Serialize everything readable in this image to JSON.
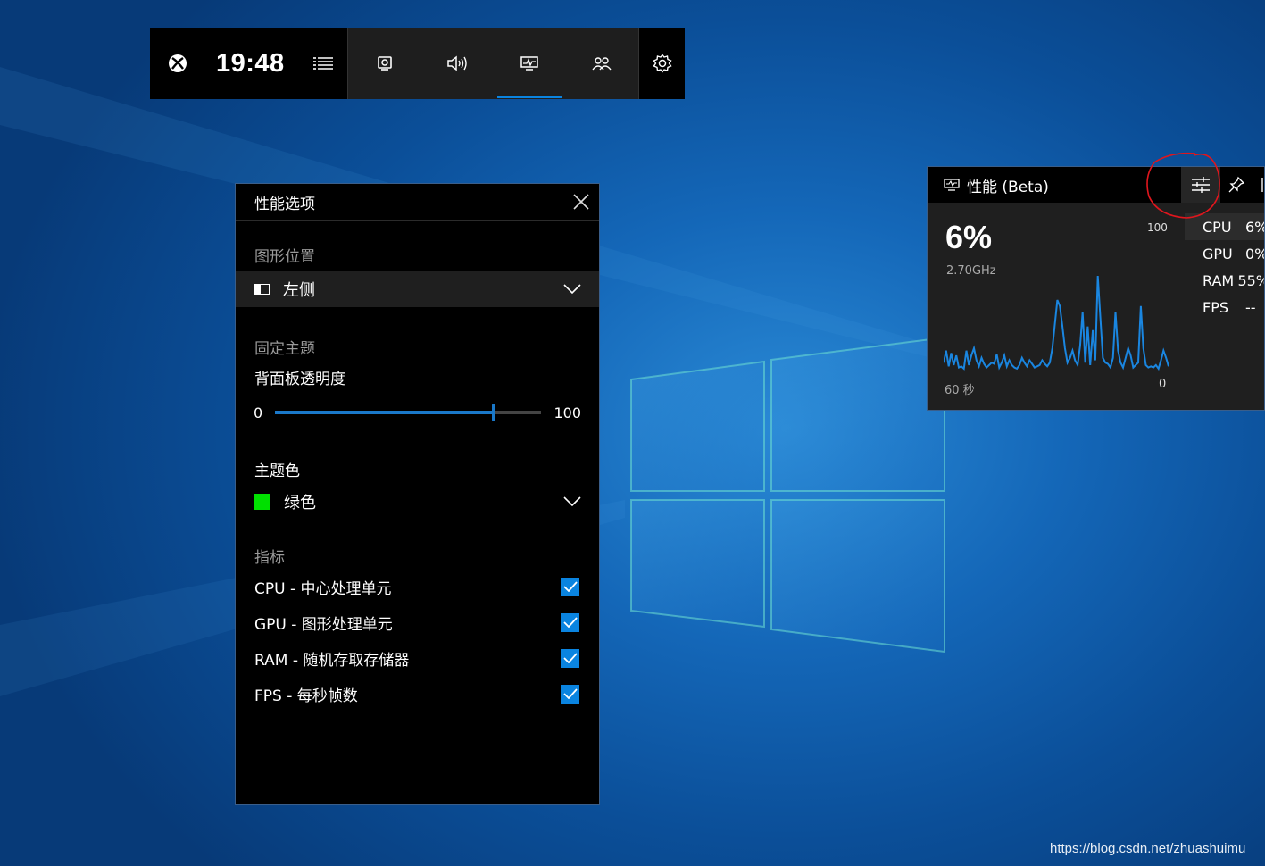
{
  "gamebar": {
    "time": "19:48",
    "icons": [
      "xbox-icon",
      "widget-menu-icon",
      "capture-icon",
      "audio-icon",
      "performance-icon",
      "social-icon",
      "settings-gear-icon"
    ],
    "active_tab": "performance"
  },
  "options_panel": {
    "title": "性能选项",
    "position_label": "图形位置",
    "position_value": "左侧",
    "pin_theme_label": "固定主题",
    "opacity_label": "背面板透明度",
    "opacity_min": "0",
    "opacity_max": "100",
    "opacity_value": 82,
    "theme_color_label": "主题色",
    "theme_color_value": "绿色",
    "theme_color_hex": "#00e000",
    "metrics_label": "指标",
    "metrics": [
      {
        "label": "CPU - 中心处理单元",
        "checked": true
      },
      {
        "label": "GPU - 图形处理单元",
        "checked": true
      },
      {
        "label": "RAM - 随机存取存储器",
        "checked": true
      },
      {
        "label": "FPS - 每秒帧数",
        "checked": true
      }
    ]
  },
  "perf_widget": {
    "title": "性能 (Beta)",
    "big_value": "6%",
    "frequency": "2.70GHz",
    "y_max": "100",
    "y_min": "0",
    "time_span": "60 秒",
    "cpu_history": [
      8,
      18,
      5,
      16,
      6,
      14,
      4,
      5,
      3,
      18,
      6,
      14,
      20,
      10,
      5,
      12,
      7,
      4,
      6,
      8,
      7,
      15,
      4,
      8,
      14,
      5,
      10,
      6,
      4,
      3,
      6,
      12,
      8,
      5,
      10,
      7,
      4,
      5,
      6,
      10,
      7,
      5,
      8,
      20,
      40,
      60,
      55,
      38,
      20,
      8,
      12,
      18,
      10,
      6,
      22,
      50,
      8,
      38,
      6,
      35,
      10,
      80,
      45,
      12,
      8,
      7,
      4,
      12,
      50,
      18,
      8,
      4,
      12,
      20,
      14,
      4,
      6,
      8,
      55,
      20,
      6,
      4,
      5,
      4,
      6,
      3,
      10,
      18,
      12,
      5
    ],
    "sidebar": [
      {
        "name": "CPU",
        "value": "6%",
        "selected": true
      },
      {
        "name": "GPU",
        "value": "0%",
        "selected": false
      },
      {
        "name": "RAM",
        "value": "55%",
        "selected": false
      },
      {
        "name": "FPS",
        "value": "--",
        "selected": false
      }
    ]
  },
  "colors": {
    "accent": "#0a84e0",
    "annotation": "#e0161d"
  },
  "watermark": "https://blog.csdn.net/zhuashuimu"
}
